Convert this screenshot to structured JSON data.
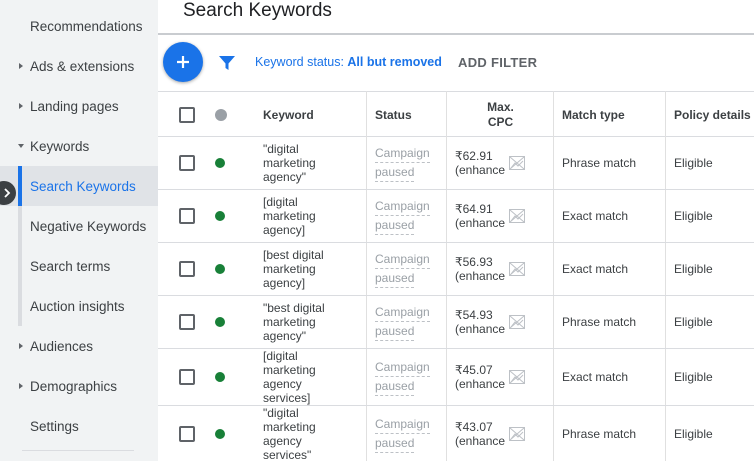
{
  "sidebar": {
    "items": [
      {
        "label": "Recommendations",
        "arrow": "none"
      },
      {
        "label": "Ads & extensions",
        "arrow": "right"
      },
      {
        "label": "Landing pages",
        "arrow": "right"
      },
      {
        "label": "Keywords",
        "arrow": "down"
      },
      {
        "label": "Search Keywords",
        "arrow": "none",
        "active": true
      },
      {
        "label": "Negative Keywords",
        "arrow": "none"
      },
      {
        "label": "Search terms",
        "arrow": "none"
      },
      {
        "label": "Auction insights",
        "arrow": "none"
      },
      {
        "label": "Audiences",
        "arrow": "right"
      },
      {
        "label": "Demographics",
        "arrow": "right"
      },
      {
        "label": "Settings",
        "arrow": "none"
      }
    ]
  },
  "header": {
    "title": "Search Keywords"
  },
  "toolbar": {
    "status_prefix": "Keyword status: ",
    "status_value": "All but removed",
    "add_filter": "ADD FILTER"
  },
  "table": {
    "headers": {
      "keyword": "Keyword",
      "status": "Status",
      "max_cpc_line1": "Max.",
      "max_cpc_line2": "CPC",
      "match_type": "Match type",
      "policy": "Policy details"
    },
    "rows": [
      {
        "keyword": "\"digital marketing agency\"",
        "status_line1": "Campaign",
        "status_line2": "paused",
        "cpc": "₹62.91",
        "cpc_note": "(enhance",
        "match": "Phrase match",
        "policy": "Eligible"
      },
      {
        "keyword": "[digital marketing agency]",
        "status_line1": "Campaign",
        "status_line2": "paused",
        "cpc": "₹64.91",
        "cpc_note": "(enhance",
        "match": "Exact match",
        "policy": "Eligible"
      },
      {
        "keyword": "[best digital marketing agency]",
        "status_line1": "Campaign",
        "status_line2": "paused",
        "cpc": "₹56.93",
        "cpc_note": "(enhance",
        "match": "Exact match",
        "policy": "Eligible"
      },
      {
        "keyword": "\"best digital marketing agency\"",
        "status_line1": "Campaign",
        "status_line2": "paused",
        "cpc": "₹54.93",
        "cpc_note": "(enhance",
        "match": "Phrase match",
        "policy": "Eligible"
      },
      {
        "keyword": "[digital marketing agency services]",
        "status_line1": "Campaign",
        "status_line2": "paused",
        "cpc": "₹45.07",
        "cpc_note": "(enhance",
        "match": "Exact match",
        "policy": "Eligible"
      },
      {
        "keyword": "\"digital marketing agency services\"",
        "status_line1": "Campaign",
        "status_line2": "paused",
        "cpc": "₹43.07",
        "cpc_note": "(enhance",
        "match": "Phrase match",
        "policy": "Eligible"
      }
    ]
  },
  "colors": {
    "accent": "#1a73e8",
    "enabled_dot": "#188038",
    "header_dot": "#9aa0a6"
  }
}
